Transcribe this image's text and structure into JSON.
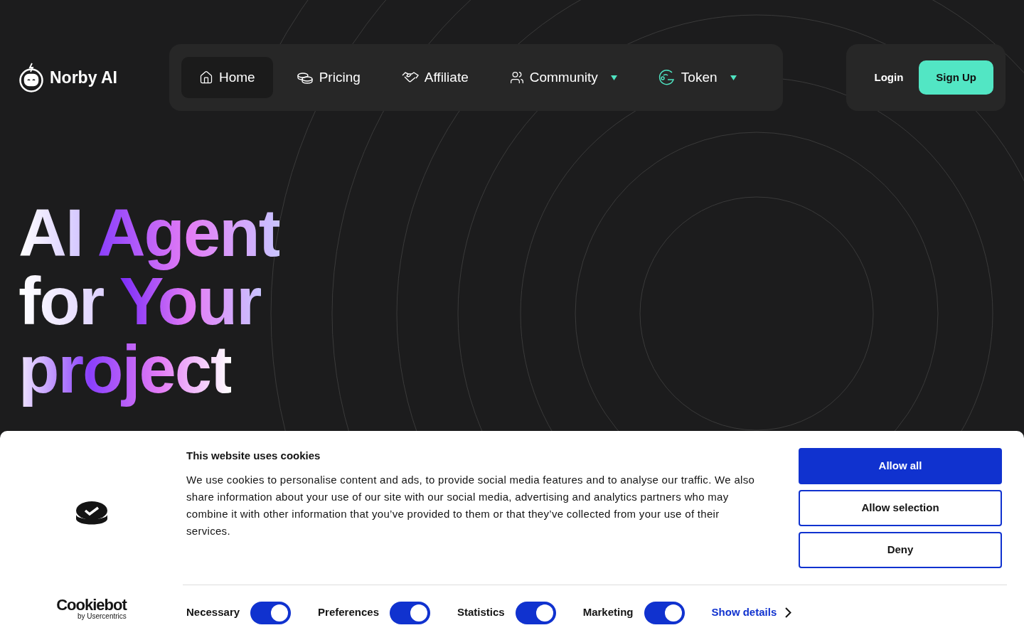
{
  "brand": {
    "name": "Norby AI"
  },
  "nav": [
    {
      "label": "Home",
      "selected": true,
      "dropdown": false
    },
    {
      "label": "Pricing",
      "selected": false,
      "dropdown": false
    },
    {
      "label": "Affiliate",
      "selected": false,
      "dropdown": false
    },
    {
      "label": "Community",
      "selected": false,
      "dropdown": true
    },
    {
      "label": "Token",
      "selected": false,
      "dropdown": true
    }
  ],
  "auth": {
    "login": "Login",
    "signup": "Sign Up"
  },
  "hero": {
    "lines": [
      [
        "AI",
        "Agent"
      ],
      [
        "for",
        "Your"
      ],
      [
        "project"
      ]
    ]
  },
  "cookie_banner": {
    "title": "This website uses cookies",
    "text": "We use cookies to personalise content and ads, to provide social media features and to analyse our traffic. We also share information about your use of our site with our social media, advertising and analytics partners who may combine it with other information that you’ve provided to them or that they’ve collected from your use of their services.",
    "logo": "Cookiebot",
    "logo_sub": "by Usercentrics",
    "buttons": [
      {
        "label": "Allow all",
        "kind": "primary"
      },
      {
        "label": "Allow selection",
        "kind": "outline"
      },
      {
        "label": "Deny",
        "kind": "outline"
      }
    ],
    "toggles": [
      {
        "label": "Necessary",
        "on": true
      },
      {
        "label": "Preferences",
        "on": true
      },
      {
        "label": "Statistics",
        "on": true
      },
      {
        "label": "Marketing",
        "on": true
      }
    ],
    "details_link": "Show details"
  }
}
